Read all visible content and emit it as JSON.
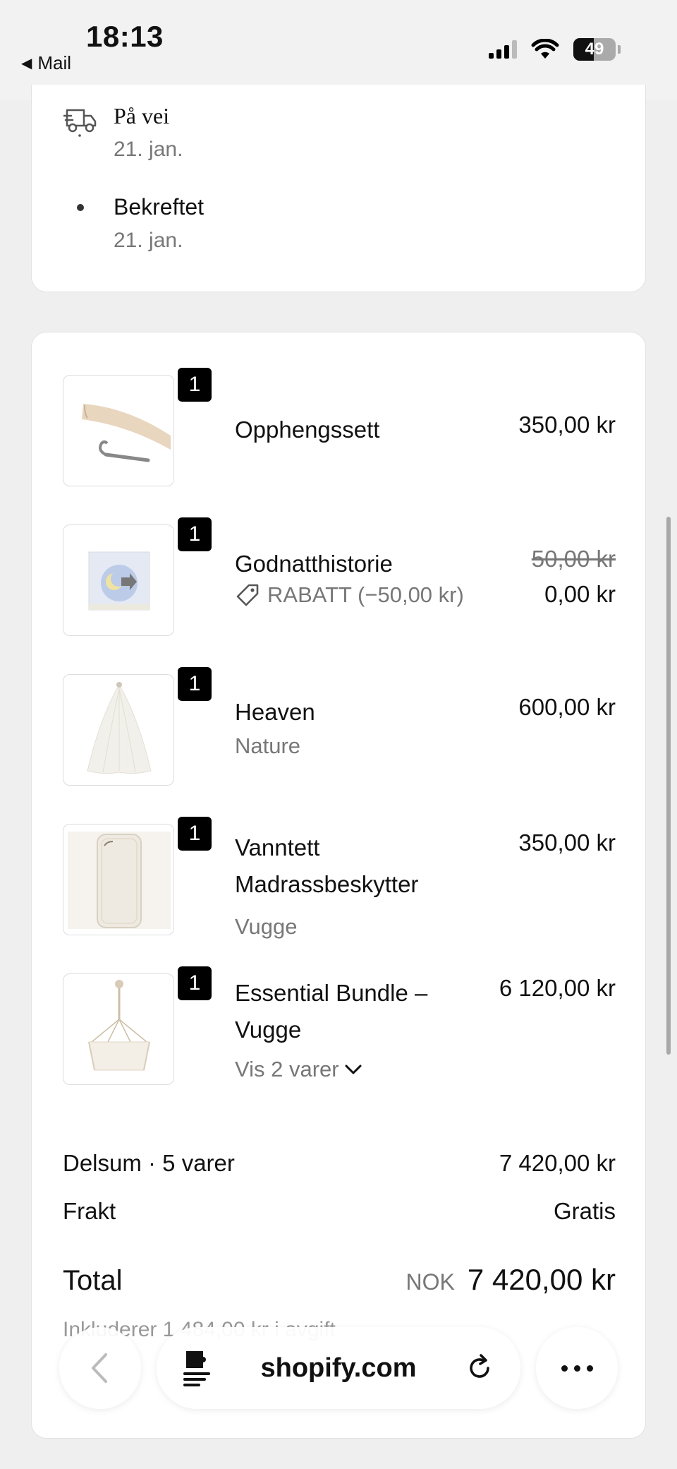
{
  "status_bar": {
    "time": "18:13",
    "back_label": "Mail",
    "battery": "49"
  },
  "timeline": [
    {
      "title": "På vei",
      "date": "21. jan.",
      "icon": "truck-icon"
    },
    {
      "title": "Bekreftet",
      "date": "21. jan.",
      "icon": "dot-icon"
    }
  ],
  "items": [
    {
      "qty": "1",
      "name": "Opphengssett",
      "price": "350,00 kr"
    },
    {
      "qty": "1",
      "name": "Godnatthistorie",
      "original_price": "50,00 kr",
      "price": "0,00 kr",
      "discount": "RABATT (−50,00 kr)"
    },
    {
      "qty": "1",
      "name": "Heaven",
      "variant": "Nature",
      "price": "600,00 kr"
    },
    {
      "qty": "1",
      "name": "Vanntett Madrassbeskytter",
      "variant": "Vugge",
      "price": "350,00 kr"
    },
    {
      "qty": "1",
      "name": "Essential Bundle – Vugge",
      "expand_label": "Vis 2 varer",
      "price": "6 120,00 kr"
    }
  ],
  "summary": {
    "subtotal_label": "Delsum · 5 varer",
    "subtotal_value": "7 420,00 kr",
    "shipping_label": "Frakt",
    "shipping_value": "Gratis",
    "total_label": "Total",
    "currency": "NOK",
    "total_value": "7 420,00 kr",
    "faded_line": "Inkluderer 1 484,00 kr i avgift"
  },
  "browser": {
    "domain": "shopify.com"
  }
}
